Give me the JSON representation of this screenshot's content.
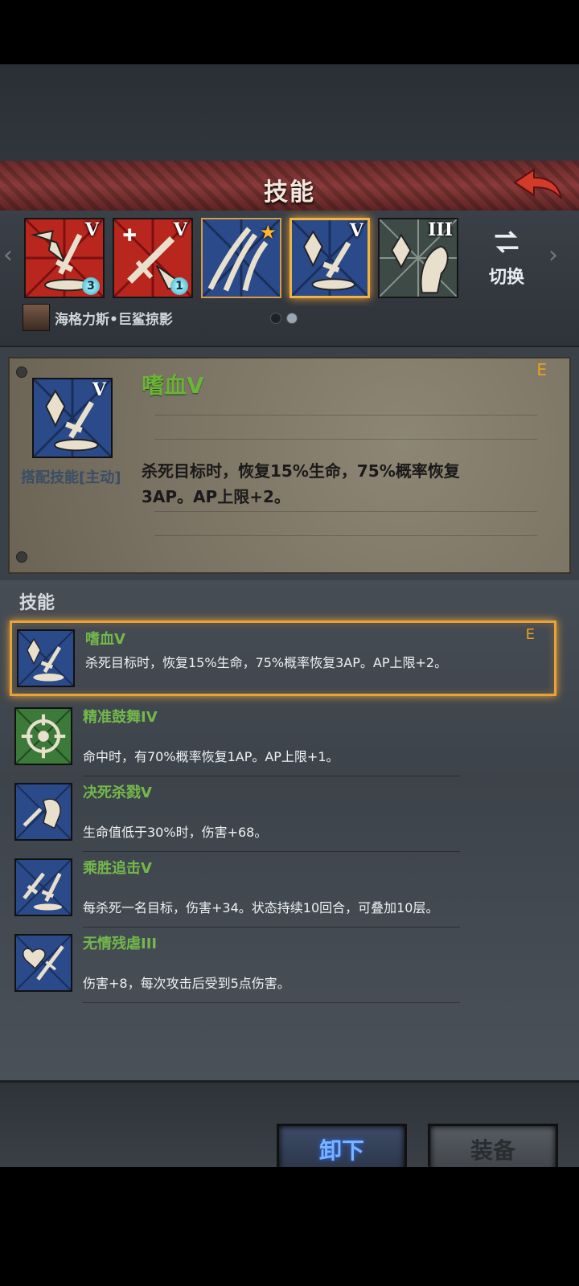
{
  "header": {
    "title": "技能"
  },
  "slots": [
    {
      "rank": "V",
      "gem": "3"
    },
    {
      "rank": "V",
      "gem": "1"
    },
    {
      "rank": ""
    },
    {
      "rank": "V"
    },
    {
      "rank": "III"
    }
  ],
  "switch": {
    "label": "切换"
  },
  "hero": {
    "name": "海格力斯•巨鲨掠影"
  },
  "detail": {
    "name": "嗜血V",
    "grade": "E",
    "type": "搭配技能[主动]",
    "rank": "V",
    "desc": "杀死目标时，恢复15%生命，75%概率恢复3AP。AP上限+2。"
  },
  "list": {
    "title": "技能",
    "items": [
      {
        "name": "嗜血V",
        "desc": "杀死目标时，恢复15%生命，75%概率恢复3AP。AP上限+2。",
        "grade": "E"
      },
      {
        "name": "精准鼓舞IV",
        "desc": "命中时，有70%概率恢复1AP。AP上限+1。"
      },
      {
        "name": "决死杀戮V",
        "desc": "生命值低于30%时，伤害+68。"
      },
      {
        "name": "乘胜追击V",
        "desc": "每杀死一名目标，伤害+34。状态持续10回合，可叠加10层。"
      },
      {
        "name": "无情残虐III",
        "desc": "伤害+8，每次攻击后受到5点伤害。"
      }
    ]
  },
  "buttons": {
    "unload": "卸下",
    "equip": "装备"
  },
  "colors": {
    "skill_name": "#6bb33a",
    "grade": "#e6a220",
    "selection": "#f2b440"
  }
}
